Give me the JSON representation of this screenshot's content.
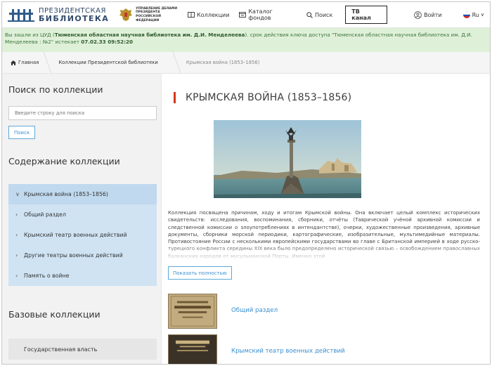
{
  "header": {
    "logo_line1": "ПРЕЗИДЕНТСКАЯ",
    "logo_line2": "БИБЛИОТЕКА",
    "admin_line1": "УПРАВЛЕНИЕ ДЕЛАМИ ПРЕЗИДЕНТА",
    "admin_line2": "РОССИЙСКОЙ ФЕДЕРАЦИИ",
    "nav": [
      {
        "label": "Коллекции",
        "icon": "collections-icon"
      },
      {
        "label": "Каталог фондов",
        "icon": "catalog-icon"
      },
      {
        "label": "Поиск",
        "icon": "search-icon"
      }
    ],
    "tv_label": "ТВ канал",
    "login_label": "Войти",
    "lang_label": "Ru"
  },
  "notice": {
    "prefix": "Вы зашли из ЦУД (",
    "org": "Тюменская областная научная библиотека им. Д.И. Менделеева",
    "middle": "). срок действия ключа доступа \"Тюменская областная научная библиотека им. Д.И. Менделеева : №2\" истекает ",
    "expires": "07.02.33 09:52:20"
  },
  "breadcrumb": [
    "Главная",
    "Коллекции Президентской библиотеки",
    "Крымская война (1853–1856)"
  ],
  "sidebar": {
    "search_heading": "Поиск по коллекции",
    "search_placeholder": "Введите строку для поиска",
    "search_button": "Поиск",
    "contents_heading": "Содержание коллекции",
    "tree": [
      {
        "label": "Крымская война (1853–1856)",
        "active": true
      },
      {
        "label": "Общий раздел"
      },
      {
        "label": "Крымский театр военных действий"
      },
      {
        "label": "Другие театры военных действий"
      },
      {
        "label": "Память о войне"
      }
    ],
    "base_heading": "Базовые коллекции",
    "base_item": "Государственная власть"
  },
  "main": {
    "title": "КРЫМСКАЯ ВОЙНА (1853–1856)",
    "description": "Коллекция посвящена причинам, ходу и итогам Крымской войны. Она включает целый комплекс исторических свидетельств: исследования, воспоминания, сборники, отчёты (Таврической учёной архивной комиссии и следственной комиссии о злоупотреблениях в интендантстве), очерки, художественные произведения, архивные документы, сборники морской периодики, картографические, изобразительные, мультимедийные материалы. Противостояние России с несколькими европейскими государствами во главе с Британской империей в ходе русско-турецкого конфликта середины XIX века было предопределено исторической связью – освобождением православных балканских народов от мусульманской Порты. Именно этой",
    "more_button": "Показать полностью",
    "items": [
      {
        "label": "Общий раздел"
      },
      {
        "label": "Крымский театр военных действий"
      }
    ]
  },
  "colors": {
    "accent_red": "#d9361a",
    "link_blue": "#3a8fd0",
    "notice_bg": "#dff0d8",
    "tree_bg": "#cfe3f3"
  }
}
